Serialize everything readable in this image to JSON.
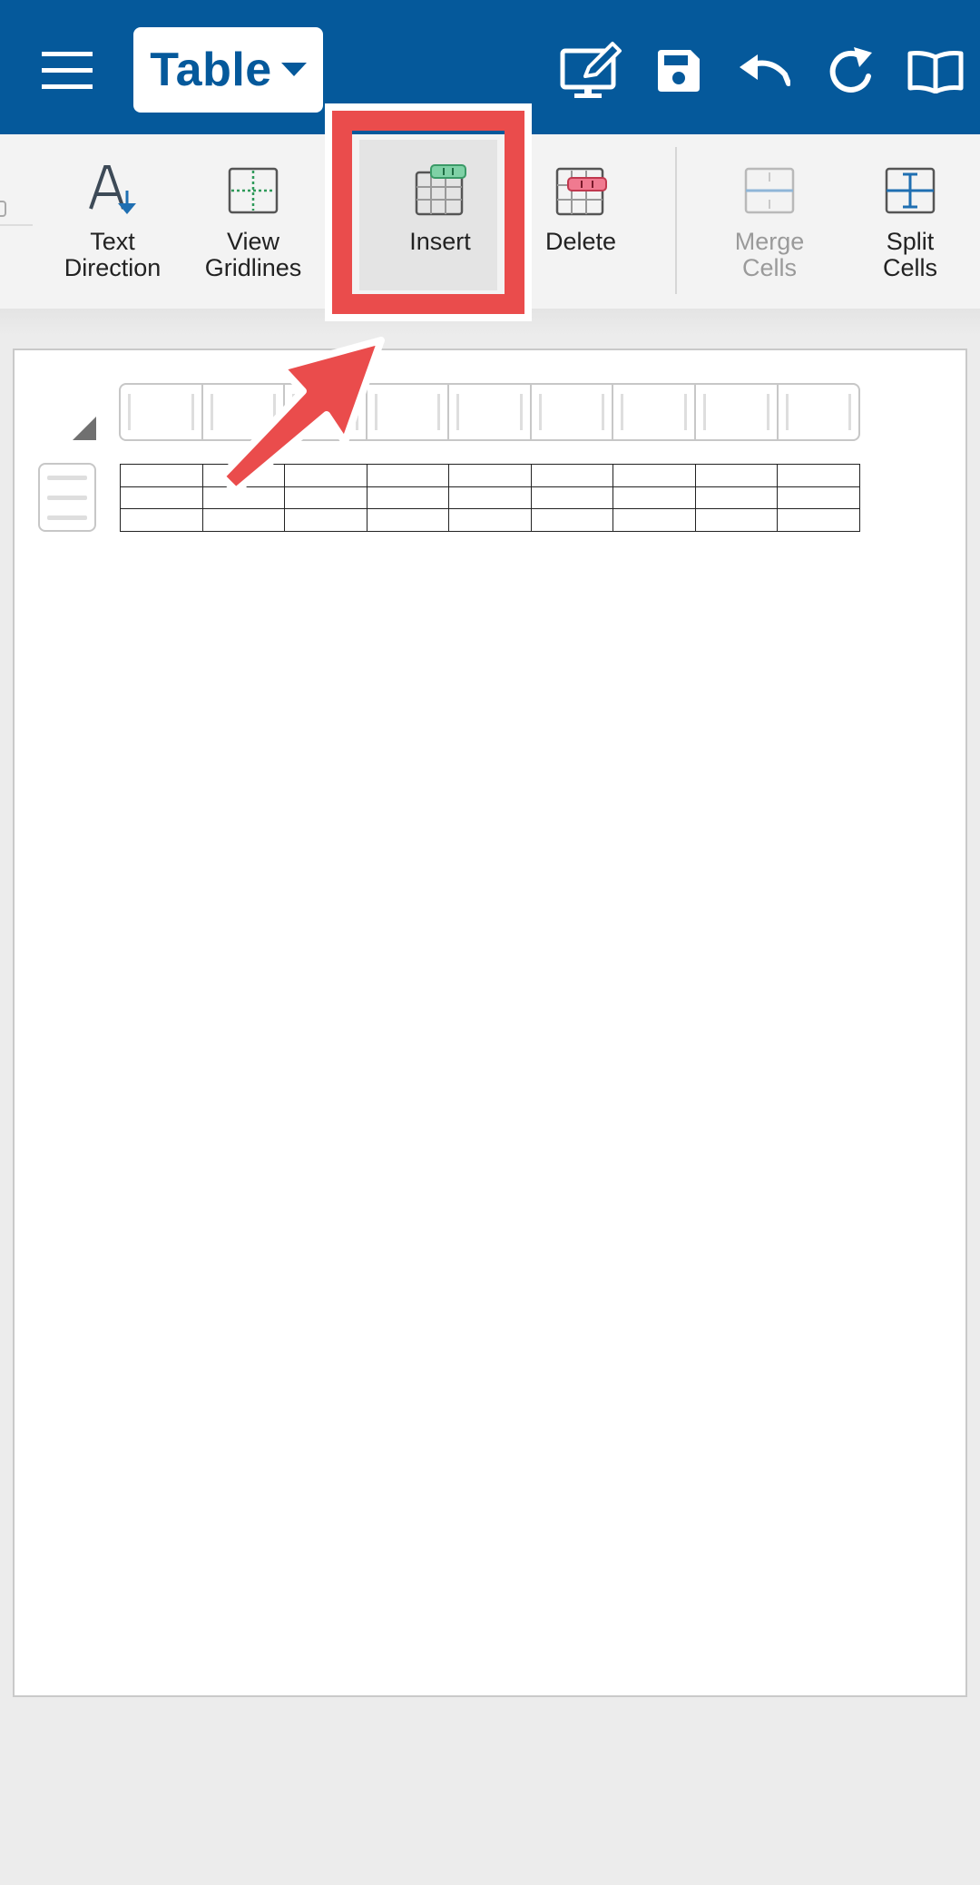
{
  "app_bar": {
    "mode_label": "Table",
    "icons": {
      "menu": "hamburger-menu-icon",
      "mode_dropdown": "caret-down-icon",
      "present": "monitor-pen-icon",
      "save": "floppy-disk-icon",
      "undo": "undo-icon",
      "redo": "redo-icon",
      "read": "open-book-icon"
    },
    "colors": {
      "bar": "#05599b",
      "selector_bg": "#ffffff"
    }
  },
  "ribbon": {
    "items": [
      {
        "id": "text-direction",
        "label": "Text\nDirection",
        "icon": "text-direction-icon",
        "enabled": true
      },
      {
        "id": "view-gridlines",
        "label": "View\nGridlines",
        "icon": "view-gridlines-icon",
        "enabled": true
      },
      {
        "id": "insert",
        "label": "Insert",
        "icon": "table-insert-icon",
        "enabled": true
      },
      {
        "id": "delete",
        "label": "Delete",
        "icon": "table-delete-icon",
        "enabled": true
      },
      {
        "id": "merge-cells",
        "label": "Merge\nCells",
        "icon": "merge-cells-icon",
        "enabled": false
      },
      {
        "id": "split-cells",
        "label": "Split\nCells",
        "icon": "split-cells-icon",
        "enabled": true
      }
    ]
  },
  "annotation": {
    "highlighted_item": "insert",
    "color": "#ea4c4c"
  },
  "document": {
    "table": {
      "rows": 3,
      "columns": 9
    }
  }
}
